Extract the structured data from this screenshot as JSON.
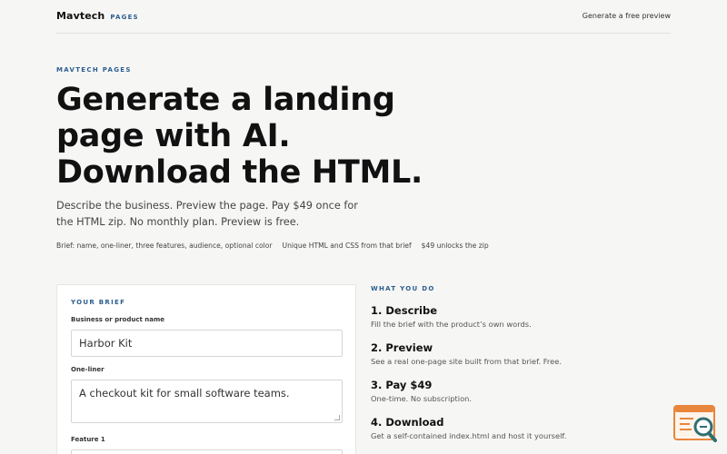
{
  "header": {
    "brand_name": "Mavtech",
    "brand_tag": "PAGES",
    "nav_link": "Generate a free preview"
  },
  "hero": {
    "eyebrow": "MAVTECH PAGES",
    "headline_lines": [
      "Generate a landing",
      "page with AI.",
      "Download the HTML."
    ],
    "subcopy": "Describe the business. Preview the page. Pay $49 once for the HTML zip. No monthly plan. Preview is free.",
    "features": [
      "Brief: name, one-liner, three features, audience, optional color",
      "Unique HTML and CSS from that brief",
      "$49 unlocks the zip"
    ]
  },
  "brief": {
    "title": "YOUR BRIEF",
    "fields": [
      {
        "label": "Business or product name",
        "value": "Harbor Kit"
      },
      {
        "label": "One-liner",
        "value": "A checkout kit for small software teams."
      },
      {
        "label": "Feature 1",
        "value": ""
      }
    ]
  },
  "steps": {
    "title": "WHAT YOU DO",
    "items": [
      {
        "title": "1. Describe",
        "desc": "Fill the brief with the product’s own words."
      },
      {
        "title": "2. Preview",
        "desc": "See a real one-page site built from that brief. Free."
      },
      {
        "title": "3. Pay $49",
        "desc": "One-time. No subscription."
      },
      {
        "title": "4. Download",
        "desc": "Get a self-contained index.html and host it yourself."
      }
    ]
  },
  "colors": {
    "accent": "#2c5d8f",
    "widget_orange": "#e9863d",
    "widget_teal": "#2f6f73"
  },
  "icons": {
    "widget": "page-search-icon"
  }
}
